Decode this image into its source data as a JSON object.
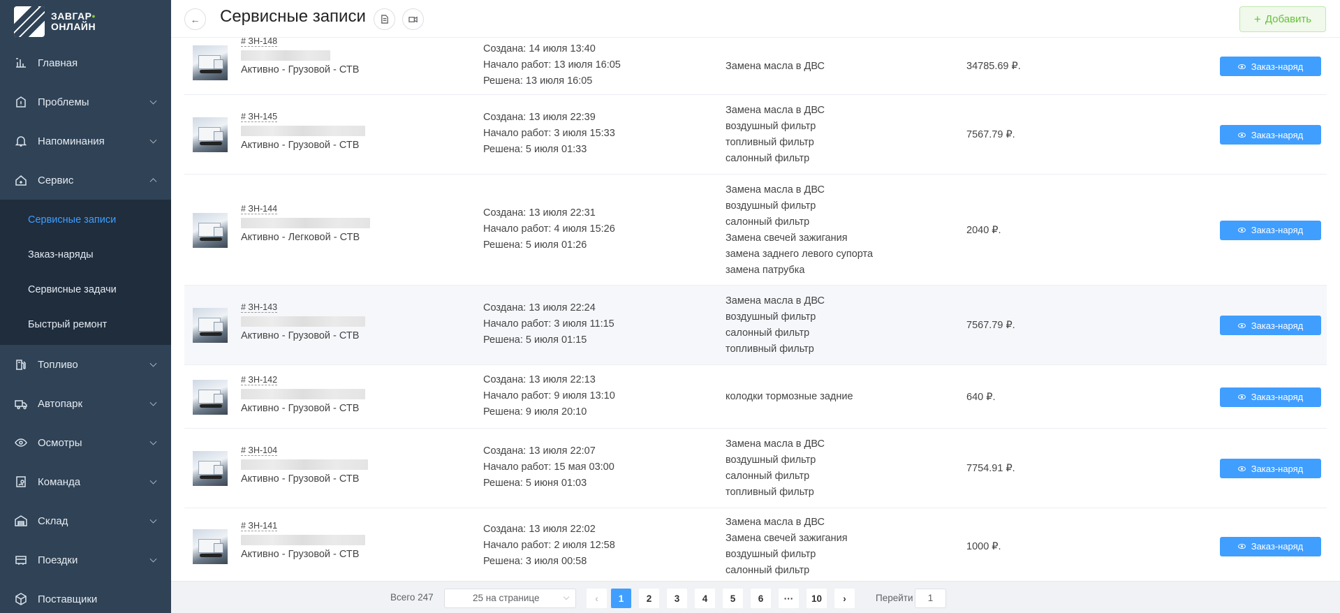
{
  "app": {
    "logo_line1": "ЗАВГАР",
    "logo_line2": "ОНЛАЙН"
  },
  "sidebar": {
    "items": [
      {
        "label": "Главная",
        "icon": "dashboard-icon",
        "chevron": false
      },
      {
        "label": "Проблемы",
        "icon": "problems-icon",
        "chevron": true
      },
      {
        "label": "Напоминания",
        "icon": "bell-icon",
        "chevron": true
      },
      {
        "label": "Сервис",
        "icon": "service-icon",
        "chevron": true,
        "expanded": true
      },
      {
        "label": "Топливо",
        "icon": "fuel-icon",
        "chevron": true
      },
      {
        "label": "Автопарк",
        "icon": "truck-icon",
        "chevron": true
      },
      {
        "label": "Осмотры",
        "icon": "eye-icon",
        "chevron": true
      },
      {
        "label": "Команда",
        "icon": "team-icon",
        "chevron": true
      },
      {
        "label": "Склад",
        "icon": "warehouse-icon",
        "chevron": true
      },
      {
        "label": "Поездки",
        "icon": "trips-icon",
        "chevron": true
      },
      {
        "label": "Поставщики",
        "icon": "suppliers-icon",
        "chevron": false
      }
    ],
    "submenu": [
      {
        "label": "Сервисные записи",
        "active": true
      },
      {
        "label": "Заказ-наряды"
      },
      {
        "label": "Сервисные задачи"
      },
      {
        "label": "Быстрый ремонт"
      }
    ]
  },
  "header": {
    "title": "Сервисные записи",
    "add_label": "Добавить"
  },
  "rows": [
    {
      "order": "# ЗН-148",
      "status": "Активно - Грузовой - СТВ",
      "created": "Создана: 14 июля 13:40",
      "started": "Начало работ: 13 июля 16:05",
      "resolved": "Решена: 13 июля 16:05",
      "works": [
        "Замена масла в ДВС"
      ],
      "cost": "34785.69 ₽.",
      "button": "Заказ-наряд"
    },
    {
      "order": "# ЗН-145",
      "status": "Активно - Грузовой - СТВ",
      "created": "Создана: 13 июля 22:39",
      "started": "Начало работ: 3 июля 15:33",
      "resolved": "Решена: 5 июля 01:33",
      "works": [
        "Замена масла в ДВС",
        "воздушный фильтр",
        "топливный фильтр",
        "салонный фильтр"
      ],
      "cost": "7567.79 ₽.",
      "button": "Заказ-наряд"
    },
    {
      "order": "# ЗН-144",
      "status": "Активно - Легковой - СТВ",
      "created": "Создана: 13 июля 22:31",
      "started": "Начало работ: 4 июля 15:26",
      "resolved": "Решена: 5 июля 01:26",
      "works": [
        "Замена масла в ДВС",
        "воздушный фильтр",
        "салонный фильтр",
        "Замена свечей зажигания",
        "замена заднего левого супорта",
        "замена патрубка"
      ],
      "cost": "2040 ₽.",
      "button": "Заказ-наряд"
    },
    {
      "order": "# ЗН-143",
      "status": "Активно - Грузовой - СТВ",
      "created": "Создана: 13 июля 22:24",
      "started": "Начало работ: 3 июля 11:15",
      "resolved": "Решена: 5 июля 01:15",
      "works": [
        "Замена масла в ДВС",
        "воздушный фильтр",
        "салонный фильтр",
        "топливный фильтр"
      ],
      "cost": "7567.79 ₽.",
      "button": "Заказ-наряд"
    },
    {
      "order": "# ЗН-142",
      "status": "Активно - Грузовой - СТВ",
      "created": "Создана: 13 июля 22:13",
      "started": "Начало работ: 9 июля 13:10",
      "resolved": "Решена: 9 июля 20:10",
      "works": [
        "колодки тормозные задние"
      ],
      "cost": "640 ₽.",
      "button": "Заказ-наряд"
    },
    {
      "order": "# ЗН-104",
      "status": "Активно - Грузовой - СТВ",
      "created": "Создана: 13 июля 22:07",
      "started": "Начало работ: 15 мая 03:00",
      "resolved": "Решена: 5 июня 01:03",
      "works": [
        "Замена масла в ДВС",
        "воздушный фильтр",
        "салонный фильтр",
        "топливный фильтр"
      ],
      "cost": "7754.91 ₽.",
      "button": "Заказ-наряд"
    },
    {
      "order": "# ЗН-141",
      "status": "Активно - Грузовой - СТВ",
      "created": "Создана: 13 июля 22:02",
      "started": "Начало работ: 2 июля 12:58",
      "resolved": "Решена: 3 июля 00:58",
      "works": [
        "Замена масла в ДВС",
        "Замена свечей зажигания",
        "воздушный фильтр",
        "салонный фильтр"
      ],
      "cost": "1000 ₽.",
      "button": "Заказ-наряд"
    }
  ],
  "pagination": {
    "total": "Всего 247",
    "per_page": "25 на странице",
    "pages": [
      "1",
      "2",
      "3",
      "4",
      "5",
      "6",
      "···",
      "10"
    ],
    "current": "1",
    "goto_label": "Перейти",
    "goto_value": "1"
  }
}
